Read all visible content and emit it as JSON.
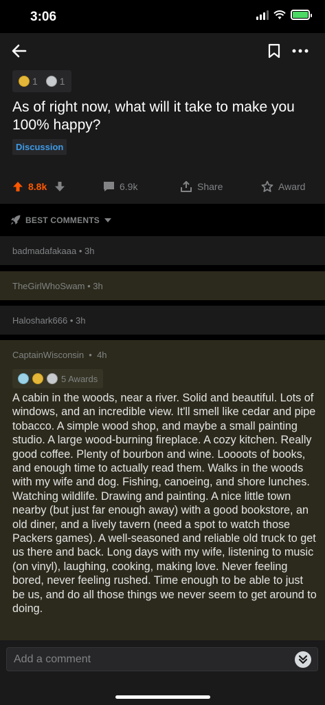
{
  "status": {
    "time": "3:06"
  },
  "post": {
    "awards": [
      {
        "icon": "gold-award-icon",
        "count": "1"
      },
      {
        "icon": "silver-award-icon",
        "count": "1"
      }
    ],
    "title": "As of right now, what will it take to make you 100% happy?",
    "flair": "Discussion",
    "upvotes": "8.8k",
    "comments": "6.9k",
    "share_label": "Share",
    "award_label": "Award"
  },
  "sort": {
    "label": "BEST COMMENTS"
  },
  "collapsed_comments": [
    {
      "author": "badmadafakaaa",
      "age": "3h"
    },
    {
      "author": "TheGirlWhoSwam",
      "age": "3h"
    },
    {
      "author": "Haloshark666",
      "age": "3h"
    }
  ],
  "comment": {
    "author": "CaptainWisconsin",
    "age": "4h",
    "awards_label": "5 Awards",
    "body": "A cabin in the woods, near a river. Solid and beautiful. Lots of windows, and an incredible view. It'll smell like cedar and pipe tobacco. A simple wood shop, and maybe a small painting studio. A large wood-burning fireplace. A cozy kitchen. Really good coffee. Plenty of bourbon and wine. Loooots of books, and enough time to actually read them. Walks in the woods with my wife and dog. Fishing, canoeing, and shore lunches. Watching wildlife. Drawing and painting. A nice little town nearby (but just far enough away) with a good bookstore, an old diner, and a lively tavern (need a spot to watch those Packers games). A well-seasoned and reliable old truck to get us there and back. Long days with my wife, listening to music (on vinyl), laughing, cooking, making love. Never feeling bored, never feeling rushed. Time enough to be able to just be us, and do all those things we never seem to get around to doing."
  },
  "input": {
    "placeholder": "Add a comment"
  },
  "colors": {
    "upvote": "#ff5700",
    "flair": "#3d9ae8",
    "highlight_bg": "#2c2a1c"
  }
}
